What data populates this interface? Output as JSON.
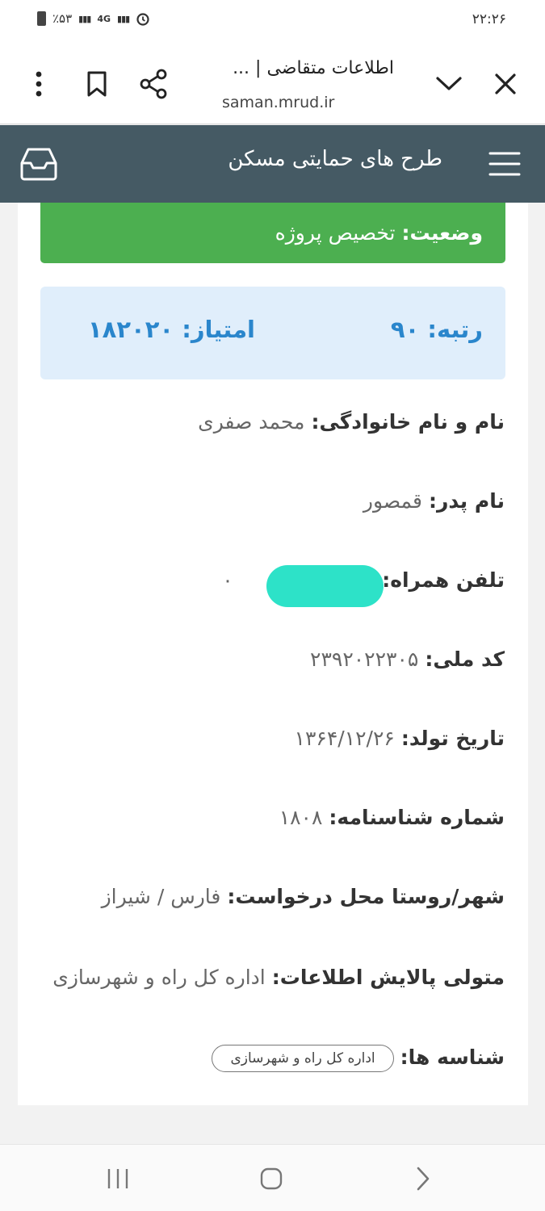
{
  "status_bar": {
    "time": "۲۲:۲۶",
    "battery": "٪۵۳",
    "network": "4G"
  },
  "browser": {
    "page_title": "اطلاعات متقاضی | ...",
    "url": "saman.mrud.ir"
  },
  "app": {
    "title": "طرح های حمایتی مسکن"
  },
  "status": {
    "label": "وضعیت:",
    "value": "تخصیص پروژه",
    "color": "#4caf50"
  },
  "ranking": {
    "rank_label": "رتبه:",
    "rank_value": "۹۰",
    "score_label": "امتیاز:",
    "score_value": "۱۸۲۰۲۰",
    "color": "#2a86cc"
  },
  "fields": {
    "name": {
      "label": "نام و نام خانوادگی:",
      "value": "محمد صفری"
    },
    "father": {
      "label": "نام پدر:",
      "value": "قمصور"
    },
    "phone": {
      "label": "تلفن همراه:",
      "value": "۰"
    },
    "national_id": {
      "label": "کد ملی:",
      "value": "۲۳۹۲۰۲۲۳۰۵"
    },
    "birth_date": {
      "label": "تاریخ تولد:",
      "value": "۱۳۶۴/۱۲/۲۶"
    },
    "id_number": {
      "label": "شماره شناسنامه:",
      "value": "۱۸۰۸"
    },
    "city": {
      "label": "شهر/روستا محل درخواست:",
      "value": "فارس / شیراز"
    },
    "custodian": {
      "label": "متولی پالایش اطلاعات:",
      "value": "اداره کل راه و شهرسازی"
    },
    "tags": {
      "label": "شناسه ها:",
      "chip": "اداره کل راه و شهرسازی"
    }
  },
  "icons": [
    "close-icon",
    "chevron-down-icon",
    "share-icon",
    "bookmark-icon",
    "more-vert-icon",
    "menu-icon",
    "inbox-icon",
    "recents-icon",
    "home-icon",
    "back-icon"
  ]
}
